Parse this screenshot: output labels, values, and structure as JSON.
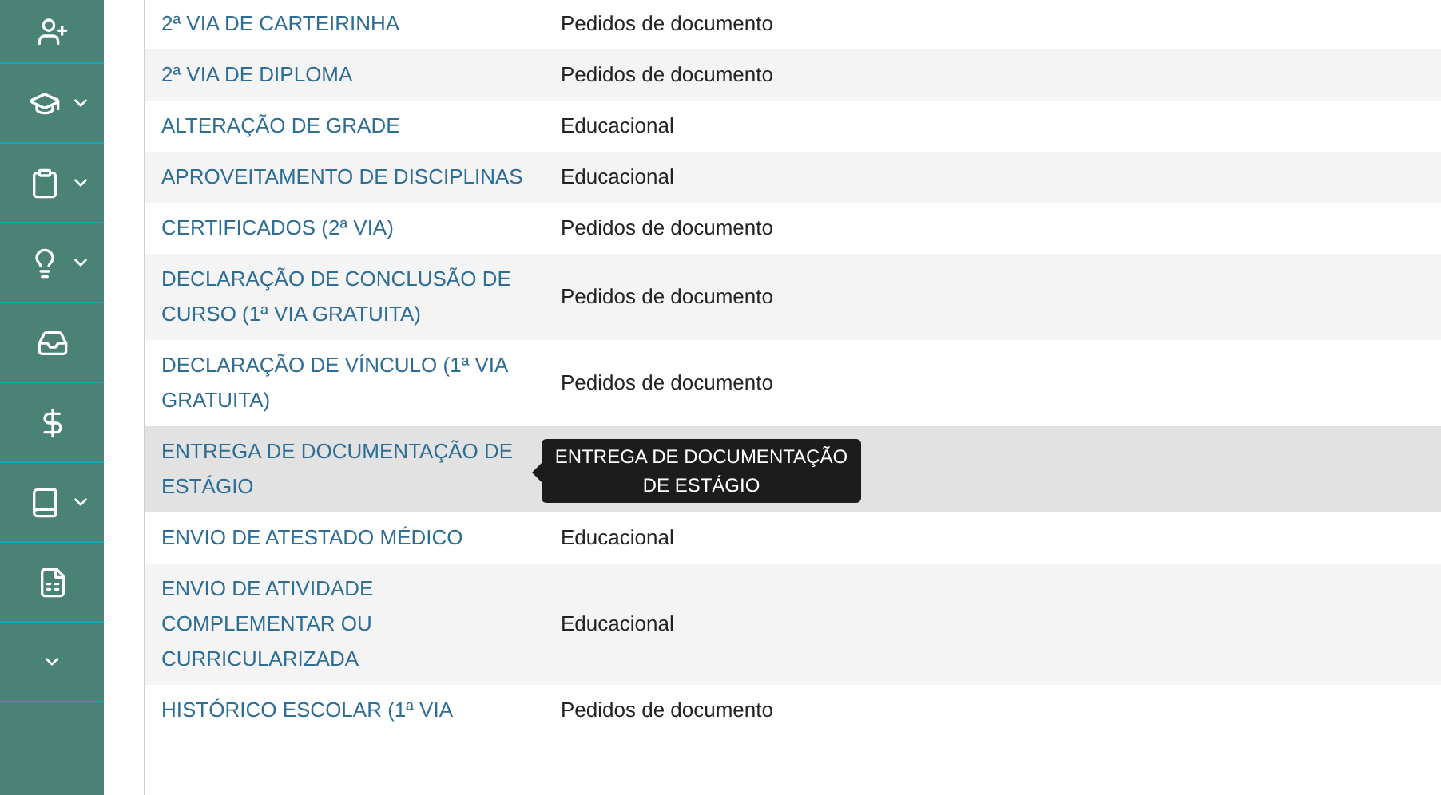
{
  "sidebar": {
    "items": [
      {
        "kind": "user-add",
        "expandable": false
      },
      {
        "kind": "graduation",
        "expandable": true
      },
      {
        "kind": "clipboard",
        "expandable": true
      },
      {
        "kind": "lightbulb",
        "expandable": true
      },
      {
        "kind": "inbox",
        "expandable": false
      },
      {
        "kind": "dollar",
        "expandable": false
      },
      {
        "kind": "book",
        "expandable": true
      },
      {
        "kind": "document",
        "expandable": false
      },
      {
        "kind": "more",
        "expandable": true
      }
    ]
  },
  "table": {
    "rows": [
      {
        "service": "2ª VIA DE CARTEIRINHA",
        "category": "Pedidos de documento",
        "hovered": false
      },
      {
        "service": "2ª VIA DE DIPLOMA",
        "category": "Pedidos de documento",
        "hovered": false
      },
      {
        "service": "ALTERAÇÃO DE GRADE",
        "category": "Educacional",
        "hovered": false
      },
      {
        "service": "APROVEITAMENTO DE DISCIPLINAS",
        "category": "Educacional",
        "hovered": false
      },
      {
        "service": "CERTIFICADOS (2ª VIA)",
        "category": "Pedidos de documento",
        "hovered": false
      },
      {
        "service": "DECLARAÇÃO DE CONCLUSÃO DE CURSO (1ª VIA GRATUITA)",
        "category": "Pedidos de documento",
        "hovered": false
      },
      {
        "service": "DECLARAÇÃO DE VÍNCULO (1ª VIA GRATUITA)",
        "category": "Pedidos de documento",
        "hovered": false
      },
      {
        "service": "ENTREGA DE DOCUMENTAÇÃO DE ESTÁGIO",
        "hovered": true,
        "tooltip": "ENTREGA DE DOCUMENTAÇÃO DE ESTÁGIO"
      },
      {
        "service": "ENVIO DE ATESTADO MÉDICO",
        "category": "Educacional",
        "hovered": false
      },
      {
        "service": "ENVIO DE ATIVIDADE COMPLEMENTAR OU CURRICULARIZADA",
        "category": "Educacional",
        "hovered": false
      },
      {
        "service": "HISTÓRICO ESCOLAR (1ª VIA",
        "category": "Pedidos de documento",
        "hovered": false
      }
    ]
  }
}
